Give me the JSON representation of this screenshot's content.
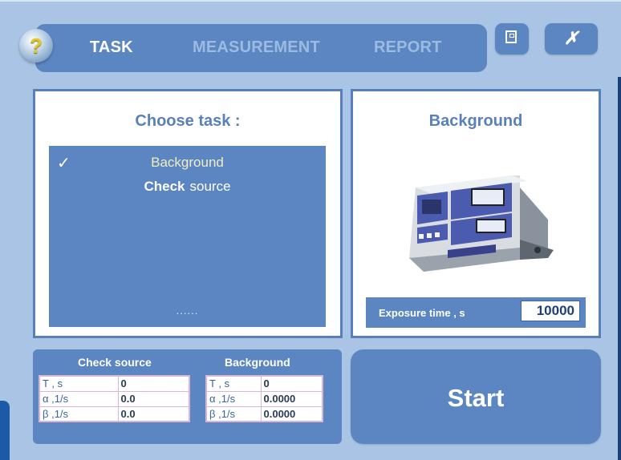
{
  "tabs": [
    {
      "label": "TASK",
      "active": true
    },
    {
      "label": "MEASUREMENT",
      "active": false
    },
    {
      "label": "REPORT",
      "active": false
    }
  ],
  "help": {
    "glyph": "?",
    "icon": "help-icon"
  },
  "window": {
    "minimize_icon": "minimize-icon",
    "close_glyph": "✗",
    "close_icon": "close-icon"
  },
  "choose_task": {
    "title": "Choose task :",
    "check_glyph": "✓",
    "items": [
      {
        "label": "Background",
        "selected": true
      },
      {
        "bold": "Check",
        "rest": "source",
        "selected": false
      }
    ],
    "more": "......"
  },
  "preview": {
    "title": "Background",
    "exposure_label": "Exposure time , s",
    "exposure_value": "10000"
  },
  "results": {
    "check_source": {
      "title": "Check source",
      "rows": [
        {
          "key": "T , s",
          "value": "0"
        },
        {
          "key": "α ,1/s",
          "value": "0.0"
        },
        {
          "key": "β ,1/s",
          "value": "0.0"
        }
      ]
    },
    "background": {
      "title": "Background",
      "rows": [
        {
          "key": "T , s",
          "value": "0"
        },
        {
          "key": "α ,1/s",
          "value": "0.0000"
        },
        {
          "key": "β ,1/s",
          "value": "0.0000"
        }
      ]
    }
  },
  "start_label": "Start",
  "colors": {
    "background": "#a9c4e4",
    "panel": "#5b86c2",
    "title_blue": "#5980b9",
    "selected_item": "#f2ecc2"
  }
}
